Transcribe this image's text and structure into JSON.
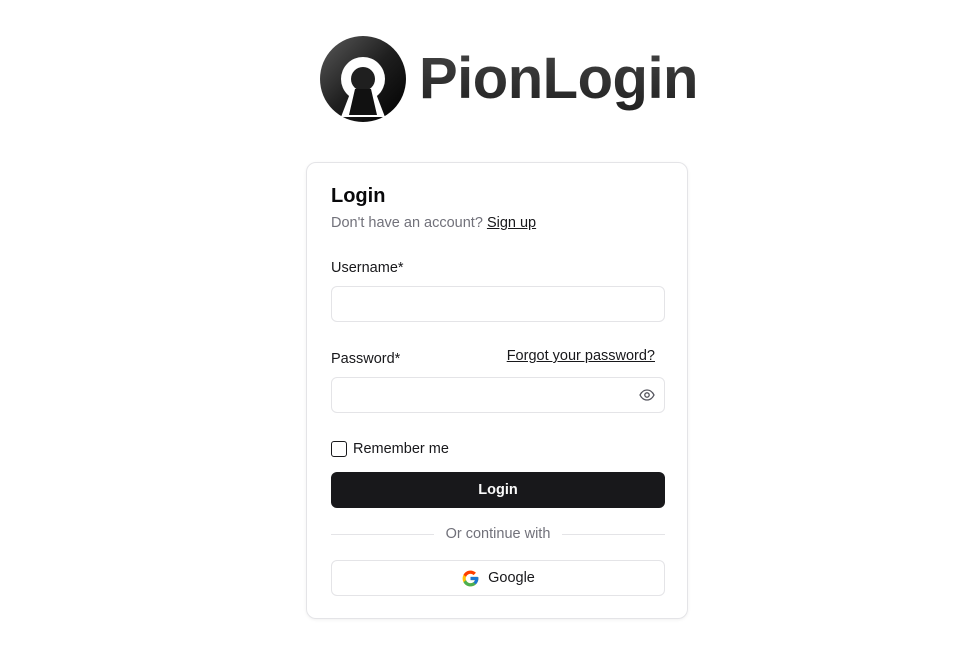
{
  "brand": {
    "name": "PionLogin",
    "icon": "keyhole-logo-icon"
  },
  "form": {
    "title": "Login",
    "no_account_text": "Don't have an account?",
    "signup_link": "Sign up",
    "username_label": "Username*",
    "username_value": "",
    "password_label": "Password*",
    "password_value": "",
    "forgot_link": "Forgot your password?",
    "show_password_icon": "eye-icon",
    "remember_label": "Remember me",
    "remember_checked": false,
    "login_button": "Login",
    "divider_text": "Or continue with",
    "google_button": "Google",
    "google_icon": "google-icon"
  },
  "colors": {
    "primary": "#18181b",
    "muted_text": "#71717a",
    "border": "#e4e4e7"
  }
}
